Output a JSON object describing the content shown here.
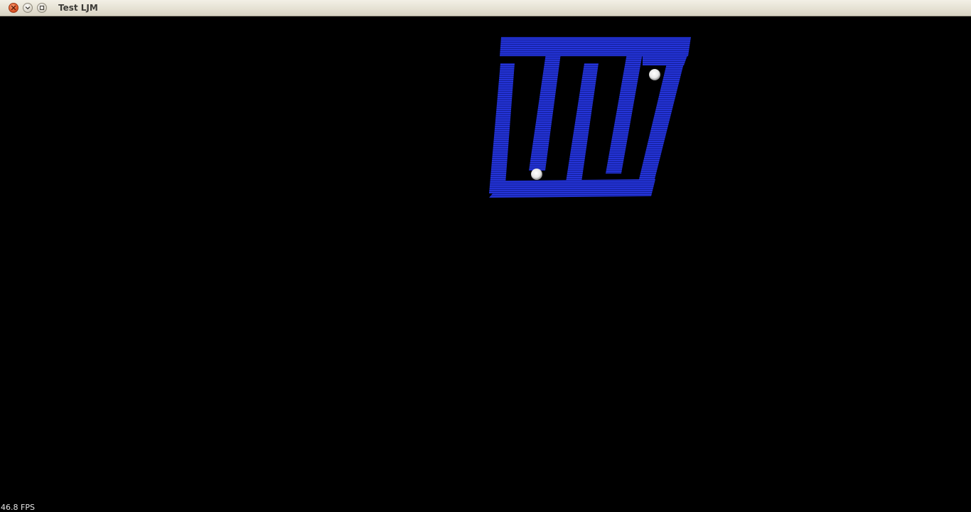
{
  "window": {
    "title": "Test LJM",
    "controls": {
      "close_icon": "close-icon",
      "minimize_icon": "chevron-down-icon",
      "maximize_icon": "maximize-icon"
    }
  },
  "scene": {
    "background_color": "#000000",
    "maze_color": "#1f2fd0",
    "ball_color": "#ffffff",
    "balls": 2
  },
  "status": {
    "fps": "46.8 FPS"
  }
}
